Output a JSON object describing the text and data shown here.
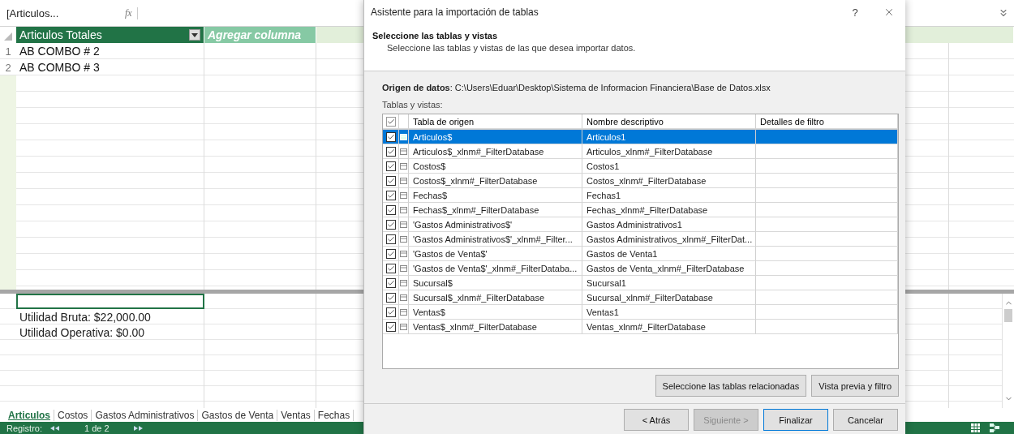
{
  "formula_bar": {
    "name_box": "[Articulos...",
    "fx": "fx"
  },
  "table": {
    "columns": [
      {
        "label": "Articulos Totales",
        "kind": "data"
      },
      {
        "label": "Agregar columna",
        "kind": "add"
      }
    ],
    "rows": [
      {
        "number": "1",
        "value": "AB COMBO # 2"
      },
      {
        "number": "2",
        "value": "AB COMBO # 3"
      }
    ]
  },
  "calc_area": {
    "cells": [
      {
        "text": null,
        "selected": true
      },
      {
        "text": "Utilidad Bruta: $22,000.00",
        "selected": false
      },
      {
        "text": "Utilidad Operativa: $0.00",
        "selected": false
      }
    ]
  },
  "sheet_tabs": [
    {
      "label": "Articulos",
      "selected": true
    },
    {
      "label": "Costos",
      "selected": false
    },
    {
      "label": "Gastos Administrativos",
      "selected": false
    },
    {
      "label": "Gastos de Venta",
      "selected": false
    },
    {
      "label": "Ventas",
      "selected": false
    },
    {
      "label": "Fechas",
      "selected": false
    }
  ],
  "status_bar": {
    "record_label": "Registro:",
    "position": "1 de 2"
  },
  "dialog": {
    "title": "Asistente para la importación de tablas",
    "help": "?",
    "heading": "Seleccione las tablas y vistas",
    "subheading": "Seleccione las tablas y vistas de las que desea importar datos.",
    "source": "**Origen de datos**: C:\\Users\\Eduar\\Desktop\\Sistema de Informacion Financiera\\Base de Datos.xlsx",
    "list_label": "Tablas y vistas:",
    "header_checked": true,
    "columns": [
      "Tabla de origen",
      "Nombre descriptivo",
      "Detalles de filtro"
    ],
    "rows": [
      {
        "source": "Articulos$",
        "name": "Articulos1",
        "checked": true,
        "selected": true
      },
      {
        "source": "Articulos$_xlnm#_FilterDatabase",
        "name": "Articulos_xlnm#_FilterDatabase",
        "checked": true,
        "selected": false
      },
      {
        "source": "Costos$",
        "name": "Costos1",
        "checked": true,
        "selected": false
      },
      {
        "source": "Costos$_xlnm#_FilterDatabase",
        "name": "Costos_xlnm#_FilterDatabase",
        "checked": true,
        "selected": false
      },
      {
        "source": "Fechas$",
        "name": "Fechas1",
        "checked": true,
        "selected": false
      },
      {
        "source": "Fechas$_xlnm#_FilterDatabase",
        "name": "Fechas_xlnm#_FilterDatabase",
        "checked": true,
        "selected": false
      },
      {
        "source": "'Gastos Administrativos$'",
        "name": "Gastos Administrativos1",
        "checked": true,
        "selected": false
      },
      {
        "source": "'Gastos Administrativos$'_xlnm#_Filter...",
        "name": "Gastos Administrativos_xlnm#_FilterDat...",
        "checked": true,
        "selected": false
      },
      {
        "source": "'Gastos de Venta$'",
        "name": "Gastos de Venta1",
        "checked": true,
        "selected": false
      },
      {
        "source": "'Gastos de Venta$'_xlnm#_FilterDataba...",
        "name": "Gastos de Venta_xlnm#_FilterDatabase",
        "checked": true,
        "selected": false
      },
      {
        "source": "Sucursal$",
        "name": "Sucursal1",
        "checked": true,
        "selected": false
      },
      {
        "source": "Sucursal$_xlnm#_FilterDatabase",
        "name": "Sucursal_xlnm#_FilterDatabase",
        "checked": true,
        "selected": false
      },
      {
        "source": "Ventas$",
        "name": "Ventas1",
        "checked": true,
        "selected": false
      },
      {
        "source": "Ventas$_xlnm#_FilterDatabase",
        "name": "Ventas_xlnm#_FilterDatabase",
        "checked": true,
        "selected": false
      }
    ],
    "tool_buttons": [
      "Seleccione las tablas relacionadas",
      "Vista previa y filtro"
    ],
    "nav_buttons": [
      {
        "label": "< Atrás",
        "disabled": false,
        "default": false
      },
      {
        "label": "Siguiente >",
        "disabled": true,
        "default": false
      },
      {
        "label": "Finalizar",
        "disabled": false,
        "default": true
      },
      {
        "label": "Cancelar",
        "disabled": false,
        "default": false
      }
    ]
  }
}
